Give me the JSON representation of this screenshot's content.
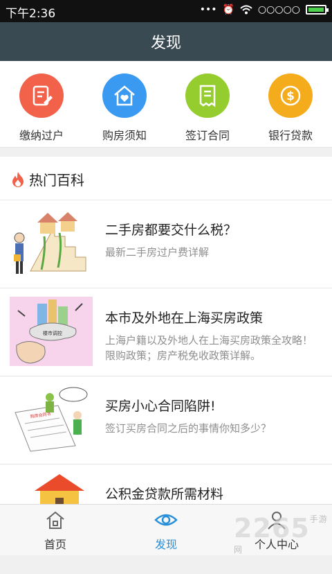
{
  "status_bar": {
    "time": "下午2:36",
    "signal_text": "○○○○○"
  },
  "header": {
    "title": "发现"
  },
  "actions": [
    {
      "label": "缴纳过户",
      "icon": "edit-document-icon",
      "color": "#f2614a"
    },
    {
      "label": "购房须知",
      "icon": "house-heart-icon",
      "color": "#3a9af2"
    },
    {
      "label": "签订合同",
      "icon": "contract-icon",
      "color": "#95cc2e"
    },
    {
      "label": "银行贷款",
      "icon": "dollar-coin-icon",
      "color": "#f5ac1c"
    }
  ],
  "hot_section": {
    "title": "热门百科"
  },
  "articles": [
    {
      "title": "二手房都要交什么税？",
      "desc": "最新二手房过户费详解",
      "thumb": "house-stairs-illustration"
    },
    {
      "title": "本市及外地在上海买房政策",
      "desc": "上海户籍以及外地人在上海买房政策全攻略！限购政策；房产税免收政策详解。",
      "thumb": "city-policy-illustration",
      "thumb_label": "楼市调控"
    },
    {
      "title": "买房小心合同陷阱!",
      "desc": "签订买房合同之后的事情你知多少？",
      "thumb": "contract-trap-illustration",
      "thumb_label": "购房合同书"
    },
    {
      "title": "公积金贷款所需材料",
      "desc": "",
      "thumb": "provident-fund-illustration"
    }
  ],
  "bottom_nav": [
    {
      "label": "首页",
      "icon": "home-icon",
      "active": false
    },
    {
      "label": "发现",
      "icon": "eye-icon",
      "active": true
    },
    {
      "label": "个人中心",
      "icon": "person-icon",
      "active": false
    }
  ],
  "watermark": {
    "brand": "2265",
    "site": "手游网"
  },
  "colors": {
    "title_bar": "#3a4a52",
    "active_tab": "#2a8fd9",
    "flame": "#f2614a"
  }
}
